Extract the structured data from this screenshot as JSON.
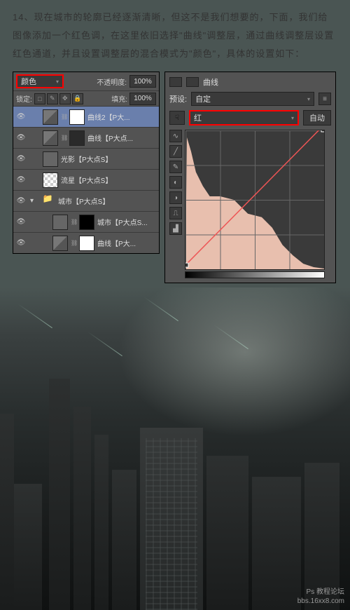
{
  "instruction": "14、现在城市的轮廓已经逐渐清晰，但这不是我们想要的，下面，我们给图像添加一个红色调，在这里依旧选择\"曲线\"调整层，通过曲线调整层设置红色通道，并且设置调整层的混合模式为\"颜色\"，具体的设置如下：",
  "layers_panel": {
    "blend_mode": "颜色",
    "opacity_label": "不透明度:",
    "opacity_value": "100%",
    "lock_label": "锁定:",
    "fill_label": "填充:",
    "fill_value": "100%",
    "lock_icons": [
      "□",
      "✎",
      "✥",
      "🔒"
    ],
    "layers": [
      {
        "name": "曲线2【P大...",
        "selected": true,
        "type": "adj",
        "mask": true,
        "link": true
      },
      {
        "name": "曲线【P大点...",
        "type": "adj",
        "mask": true,
        "link": true,
        "darkmask": true
      },
      {
        "name": "光影【P大点S】",
        "type": "img"
      },
      {
        "name": "流星【P大点S】",
        "type": "trans"
      },
      {
        "name": "城市【P大点S】",
        "type": "folder",
        "expanded": true
      },
      {
        "name": "城市【P大点S...",
        "type": "img",
        "mask": true,
        "link": true,
        "indent": true,
        "maskblack": true
      },
      {
        "name": "曲线【P大...",
        "type": "adj",
        "mask": true,
        "link": true,
        "indent": true
      }
    ]
  },
  "curves_panel": {
    "title": "曲线",
    "preset_label": "预设:",
    "preset_value": "自定",
    "channel": "红",
    "auto_label": "自动",
    "tools": [
      "∿",
      "╱",
      "✎",
      "◐",
      "◑",
      "⎍",
      "▟"
    ]
  },
  "chart_data": {
    "type": "curves-histogram",
    "channel": "red",
    "histogram_profile": "heavy-shadows-taper",
    "curve_points": [
      {
        "x": 0,
        "y": 0.03
      },
      {
        "x": 1,
        "y": 1.04
      }
    ],
    "grid": "4x4"
  },
  "watermark": {
    "line1": "Ps 教程论坛",
    "line2": "bbs.16xx8.com"
  }
}
